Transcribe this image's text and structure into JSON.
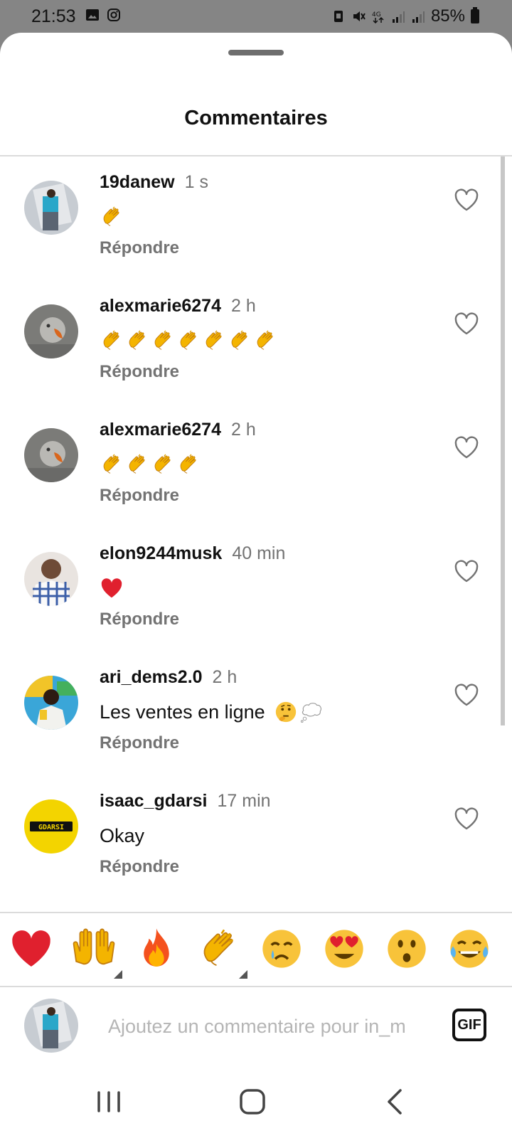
{
  "status_bar": {
    "time": "21:53",
    "battery": "85%",
    "left_icons": [
      "gallery-icon",
      "instagram-icon"
    ],
    "right_icons": [
      "alarm-icon",
      "mute-icon",
      "4g-icon",
      "signal-icon",
      "signal-icon",
      "battery-icon"
    ]
  },
  "header": {
    "title": "Commentaires"
  },
  "comments": [
    {
      "user": "19danew",
      "time": "1 s",
      "text": "",
      "emojis": [
        "clap"
      ],
      "reply": "Répondre",
      "avatar": "photo-blue"
    },
    {
      "user": "alexmarie6274",
      "time": "2 h",
      "text": "",
      "emojis": [
        "clap",
        "clap",
        "clap",
        "clap",
        "clap",
        "clap",
        "clap"
      ],
      "reply": "Répondre",
      "avatar": "photo-gray"
    },
    {
      "user": "alexmarie6274",
      "time": "2 h",
      "text": "",
      "emojis": [
        "clap",
        "clap",
        "clap",
        "clap"
      ],
      "reply": "Répondre",
      "avatar": "photo-gray"
    },
    {
      "user": "elon9244musk",
      "time": "40 min",
      "text": "",
      "emojis": [
        "heart"
      ],
      "reply": "Répondre",
      "avatar": "photo-checker"
    },
    {
      "user": "ari_dems2.0",
      "time": "2 h",
      "text": "Les ventes en ligne",
      "emojis": [
        "thinking",
        "thought-balloon"
      ],
      "reply": "Répondre",
      "avatar": "photo-yellow"
    },
    {
      "user": "isaac_gdarsi",
      "time": "17 min",
      "text": "Okay",
      "emojis": [],
      "reply": "Répondre",
      "avatar": "gdarsi-logo",
      "avatar_text": "GDARSI"
    }
  ],
  "reactions": [
    "heart",
    "raising-hands",
    "fire",
    "clap",
    "crying",
    "heart-eyes",
    "surprised",
    "tears-of-joy"
  ],
  "input": {
    "placeholder": "Ajoutez un commentaire pour in_m",
    "gif_label": "GIF"
  },
  "colors": {
    "muted": "#737373",
    "heart": "#e0202e",
    "clap_yellow": "#f4b400",
    "gdarsi_yellow": "#f3d400"
  }
}
